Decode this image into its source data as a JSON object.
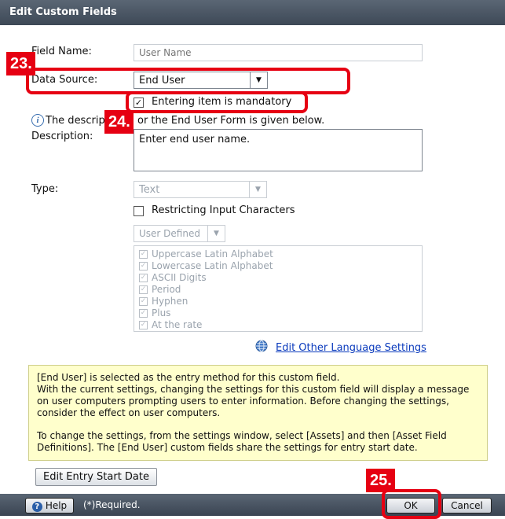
{
  "dialog": {
    "title": "Edit Custom Fields"
  },
  "form": {
    "field_name_label": "Field Name:",
    "field_name_placeholder": "User Name",
    "data_source_label": "Data Source:",
    "data_source_value": "End User",
    "mandatory_label": "Entering item is mandatory",
    "mandatory_checked": true,
    "info_text_visible": "The descrip",
    "info_text_tail": "or the End User Form is given below.",
    "description_label": "Description:",
    "description_value": "Enter end user name.",
    "type_label": "Type:",
    "type_value": "Text",
    "restrict_label": "Restricting Input Characters",
    "restrict_checked": false,
    "charset_value": "User Defined",
    "char_options": [
      {
        "label": "Uppercase Latin Alphabet",
        "checked": true
      },
      {
        "label": "Lowercase Latin Alphabet",
        "checked": true
      },
      {
        "label": "ASCII Digits",
        "checked": true
      },
      {
        "label": "Period",
        "checked": true
      },
      {
        "label": "Hyphen",
        "checked": true
      },
      {
        "label": "Plus",
        "checked": true
      },
      {
        "label": "At the rate",
        "checked": true
      }
    ],
    "other_language_link": "Edit Other Language Settings"
  },
  "notice": {
    "line1": "[End User] is selected as the entry method for this custom field.",
    "line2": "With the current settings, changing the settings for this custom field will display a message on user computers prompting users to enter information. Before changing the settings, consider the effect on user computers.",
    "line3": "To change the settings, from the settings window, select [Assets] and then [Asset Field Definitions]. The [End User] custom fields share the settings for entry start date."
  },
  "edit_entry_button": "Edit Entry Start Date",
  "footer": {
    "help_label": "Help",
    "required_note": "(*)Required.",
    "ok_label": "OK",
    "cancel_label": "Cancel"
  },
  "annotations": {
    "step23": "23.",
    "step24": "24.",
    "step25": "25.",
    "color": "#e60012"
  }
}
